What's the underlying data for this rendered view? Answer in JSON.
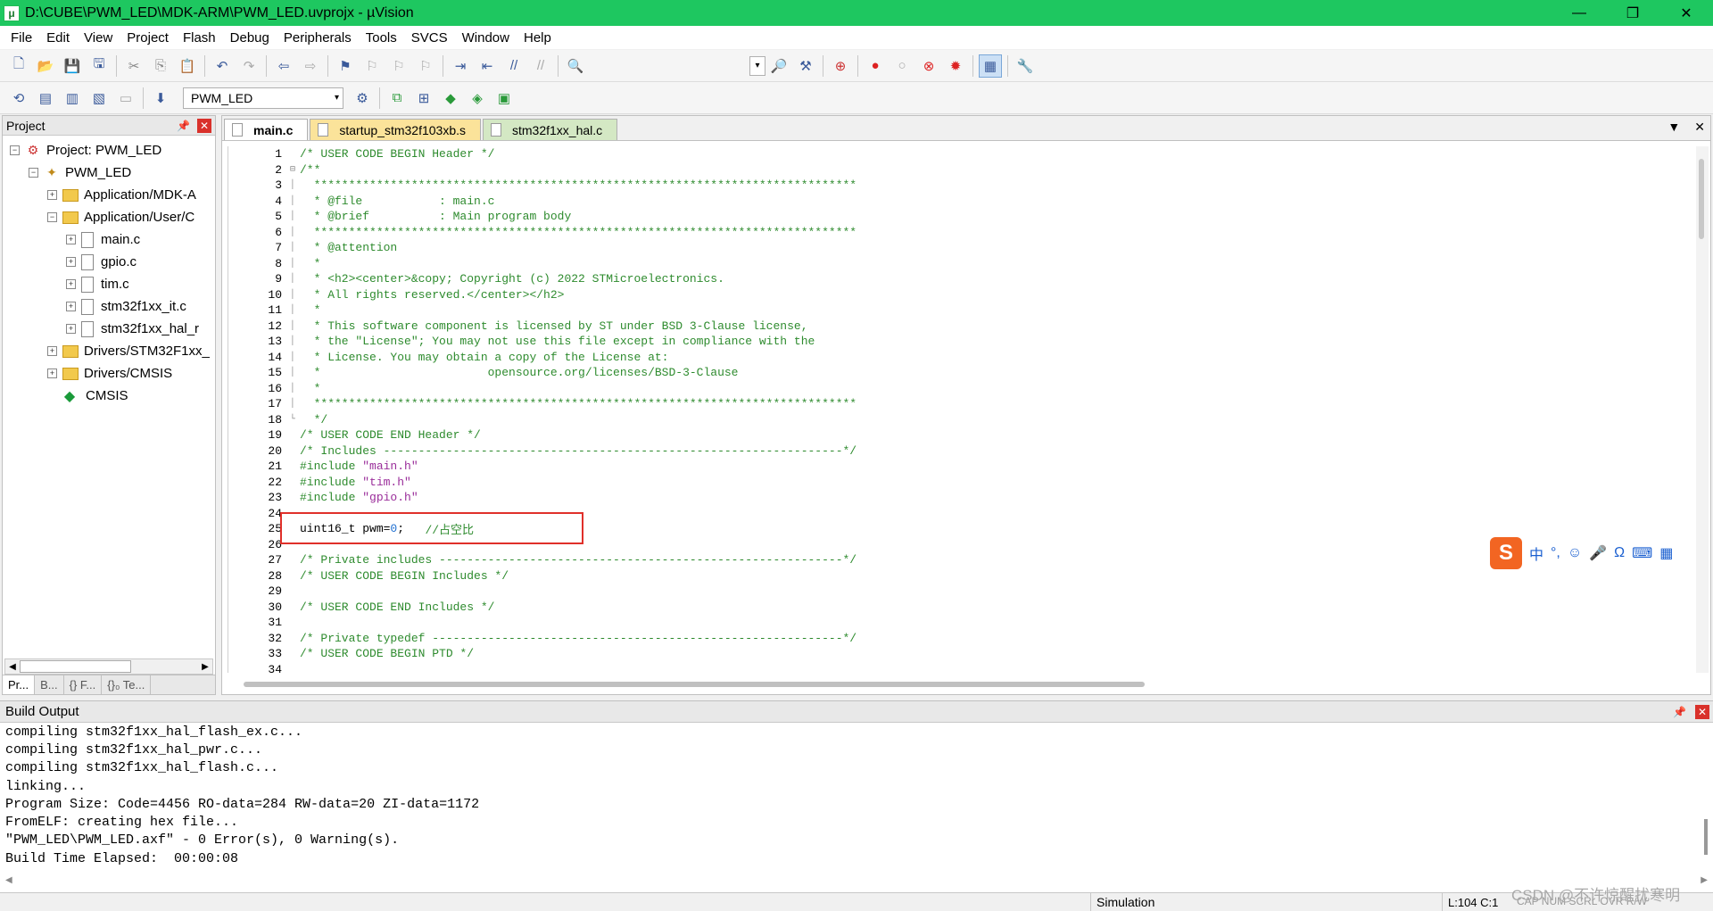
{
  "window": {
    "title": "D:\\CUBE\\PWM_LED\\MDK-ARM\\PWM_LED.uvprojx - µVision",
    "controls": [
      "—",
      "❐",
      "✕"
    ]
  },
  "menu": [
    "File",
    "Edit",
    "View",
    "Project",
    "Flash",
    "Debug",
    "Peripherals",
    "Tools",
    "SVCS",
    "Window",
    "Help"
  ],
  "toolbar2": {
    "target": "PWM_LED"
  },
  "project_pane": {
    "title": "Project",
    "tree": [
      {
        "label": "Project: PWM_LED",
        "level": 0,
        "expander": "−",
        "icon": "project"
      },
      {
        "label": "PWM_LED",
        "level": 1,
        "expander": "−",
        "icon": "target"
      },
      {
        "label": "Application/MDK-A",
        "level": 2,
        "expander": "+",
        "icon": "folder"
      },
      {
        "label": "Application/User/C",
        "level": 2,
        "expander": "−",
        "icon": "folder"
      },
      {
        "label": "main.c",
        "level": 3,
        "expander": "+",
        "icon": "file"
      },
      {
        "label": "gpio.c",
        "level": 3,
        "expander": "+",
        "icon": "file"
      },
      {
        "label": "tim.c",
        "level": 3,
        "expander": "+",
        "icon": "file"
      },
      {
        "label": "stm32f1xx_it.c",
        "level": 3,
        "expander": "+",
        "icon": "file"
      },
      {
        "label": "stm32f1xx_hal_r",
        "level": 3,
        "expander": "+",
        "icon": "file"
      },
      {
        "label": "Drivers/STM32F1xx_",
        "level": 2,
        "expander": "+",
        "icon": "folder"
      },
      {
        "label": "Drivers/CMSIS",
        "level": 2,
        "expander": "+",
        "icon": "folder"
      },
      {
        "label": "CMSIS",
        "level": 2,
        "expander": "",
        "icon": "cmsis"
      }
    ],
    "tabs": [
      "Pr...",
      "B...",
      "{} F...",
      "{}₀ Te..."
    ]
  },
  "editor": {
    "tabs": [
      {
        "label": "main.c",
        "kind": "active"
      },
      {
        "label": "startup_stm32f103xb.s",
        "kind": "startup"
      },
      {
        "label": "stm32f1xx_hal.c",
        "kind": "hal"
      }
    ],
    "lines": [
      {
        "n": "1",
        "fold": "",
        "segs": [
          {
            "t": "/* USER CODE BEGIN Header */",
            "c": "comment"
          }
        ]
      },
      {
        "n": "2",
        "fold": "⊟",
        "segs": [
          {
            "t": "/**",
            "c": "comment"
          }
        ]
      },
      {
        "n": "3",
        "fold": "│",
        "segs": [
          {
            "t": "  ******************************************************************************",
            "c": "comment"
          }
        ]
      },
      {
        "n": "4",
        "fold": "│",
        "segs": [
          {
            "t": "  * @file           : main.c",
            "c": "comment"
          }
        ]
      },
      {
        "n": "5",
        "fold": "│",
        "segs": [
          {
            "t": "  * @brief          : Main program body",
            "c": "comment"
          }
        ]
      },
      {
        "n": "6",
        "fold": "│",
        "segs": [
          {
            "t": "  ******************************************************************************",
            "c": "comment"
          }
        ]
      },
      {
        "n": "7",
        "fold": "│",
        "segs": [
          {
            "t": "  * @attention",
            "c": "comment"
          }
        ]
      },
      {
        "n": "8",
        "fold": "│",
        "segs": [
          {
            "t": "  *",
            "c": "comment"
          }
        ]
      },
      {
        "n": "9",
        "fold": "│",
        "segs": [
          {
            "t": "  * <h2><center>&copy; Copyright (c) 2022 STMicroelectronics.",
            "c": "comment"
          }
        ]
      },
      {
        "n": "10",
        "fold": "│",
        "segs": [
          {
            "t": "  * All rights reserved.</center></h2>",
            "c": "comment"
          }
        ]
      },
      {
        "n": "11",
        "fold": "│",
        "segs": [
          {
            "t": "  *",
            "c": "comment"
          }
        ]
      },
      {
        "n": "12",
        "fold": "│",
        "segs": [
          {
            "t": "  * This software component is licensed by ST under BSD 3-Clause license,",
            "c": "comment"
          }
        ]
      },
      {
        "n": "13",
        "fold": "│",
        "segs": [
          {
            "t": "  * the \"License\"; You may not use this file except in compliance with the",
            "c": "comment"
          }
        ]
      },
      {
        "n": "14",
        "fold": "│",
        "segs": [
          {
            "t": "  * License. You may obtain a copy of the License at:",
            "c": "comment"
          }
        ]
      },
      {
        "n": "15",
        "fold": "│",
        "segs": [
          {
            "t": "  *                        opensource.org/licenses/BSD-3-Clause",
            "c": "comment"
          }
        ]
      },
      {
        "n": "16",
        "fold": "│",
        "segs": [
          {
            "t": "  *",
            "c": "comment"
          }
        ]
      },
      {
        "n": "17",
        "fold": "│",
        "segs": [
          {
            "t": "  ******************************************************************************",
            "c": "comment"
          }
        ]
      },
      {
        "n": "18",
        "fold": "└",
        "segs": [
          {
            "t": "  */",
            "c": "comment"
          }
        ]
      },
      {
        "n": "19",
        "fold": "",
        "segs": [
          {
            "t": "/* USER CODE END Header */",
            "c": "comment"
          }
        ]
      },
      {
        "n": "20",
        "fold": "",
        "segs": [
          {
            "t": "/* Includes ------------------------------------------------------------------*/",
            "c": "comment"
          }
        ]
      },
      {
        "n": "21",
        "fold": "",
        "segs": [
          {
            "t": "#include ",
            "c": "pp"
          },
          {
            "t": "\"main.h\"",
            "c": "str"
          }
        ]
      },
      {
        "n": "22",
        "fold": "",
        "segs": [
          {
            "t": "#include ",
            "c": "pp"
          },
          {
            "t": "\"tim.h\"",
            "c": "str"
          }
        ]
      },
      {
        "n": "23",
        "fold": "",
        "segs": [
          {
            "t": "#include ",
            "c": "pp"
          },
          {
            "t": "\"gpio.h\"",
            "c": "str"
          }
        ]
      },
      {
        "n": "24",
        "fold": "",
        "segs": []
      },
      {
        "n": "25",
        "fold": "",
        "segs": [
          {
            "t": "uint16_t pwm=",
            "c": "ctext"
          },
          {
            "t": "0",
            "c": "num"
          },
          {
            "t": ";   ",
            "c": "ctext"
          },
          {
            "t": "//占空比",
            "c": "comment"
          }
        ]
      },
      {
        "n": "26",
        "fold": "",
        "segs": []
      },
      {
        "n": "27",
        "fold": "",
        "segs": [
          {
            "t": "/* Private includes ----------------------------------------------------------*/",
            "c": "comment"
          }
        ]
      },
      {
        "n": "28",
        "fold": "",
        "segs": [
          {
            "t": "/* USER CODE BEGIN Includes */",
            "c": "comment"
          }
        ]
      },
      {
        "n": "29",
        "fold": "",
        "segs": []
      },
      {
        "n": "30",
        "fold": "",
        "segs": [
          {
            "t": "/* USER CODE END Includes */",
            "c": "comment"
          }
        ]
      },
      {
        "n": "31",
        "fold": "",
        "segs": []
      },
      {
        "n": "32",
        "fold": "",
        "segs": [
          {
            "t": "/* Private typedef -----------------------------------------------------------*/",
            "c": "comment"
          }
        ]
      },
      {
        "n": "33",
        "fold": "",
        "segs": [
          {
            "t": "/* USER CODE BEGIN PTD */",
            "c": "comment"
          }
        ]
      },
      {
        "n": "34",
        "fold": "",
        "segs": []
      }
    ]
  },
  "ime": {
    "logo": "S",
    "items": [
      "中",
      "°,",
      "☺",
      "🎤",
      "Ω",
      "⌨",
      "▦"
    ]
  },
  "build_output": {
    "title": "Build Output",
    "lines": [
      "compiling stm32f1xx_hal_flash_ex.c...",
      "compiling stm32f1xx_hal_pwr.c...",
      "compiling stm32f1xx_hal_flash.c...",
      "linking...",
      "Program Size: Code=4456 RO-data=284 RW-data=20 ZI-data=1172",
      "FromELF: creating hex file...",
      "\"PWM_LED\\PWM_LED.axf\" - 0 Error(s), 0 Warning(s).",
      "Build Time Elapsed:  00:00:08"
    ]
  },
  "statusbar": {
    "mode": "Simulation",
    "position": "L:104 C:1",
    "keys": "CAP  NUM  SCRL  OVR  R/W",
    "watermark": "CSDN @不许惊醒扰寒明"
  }
}
